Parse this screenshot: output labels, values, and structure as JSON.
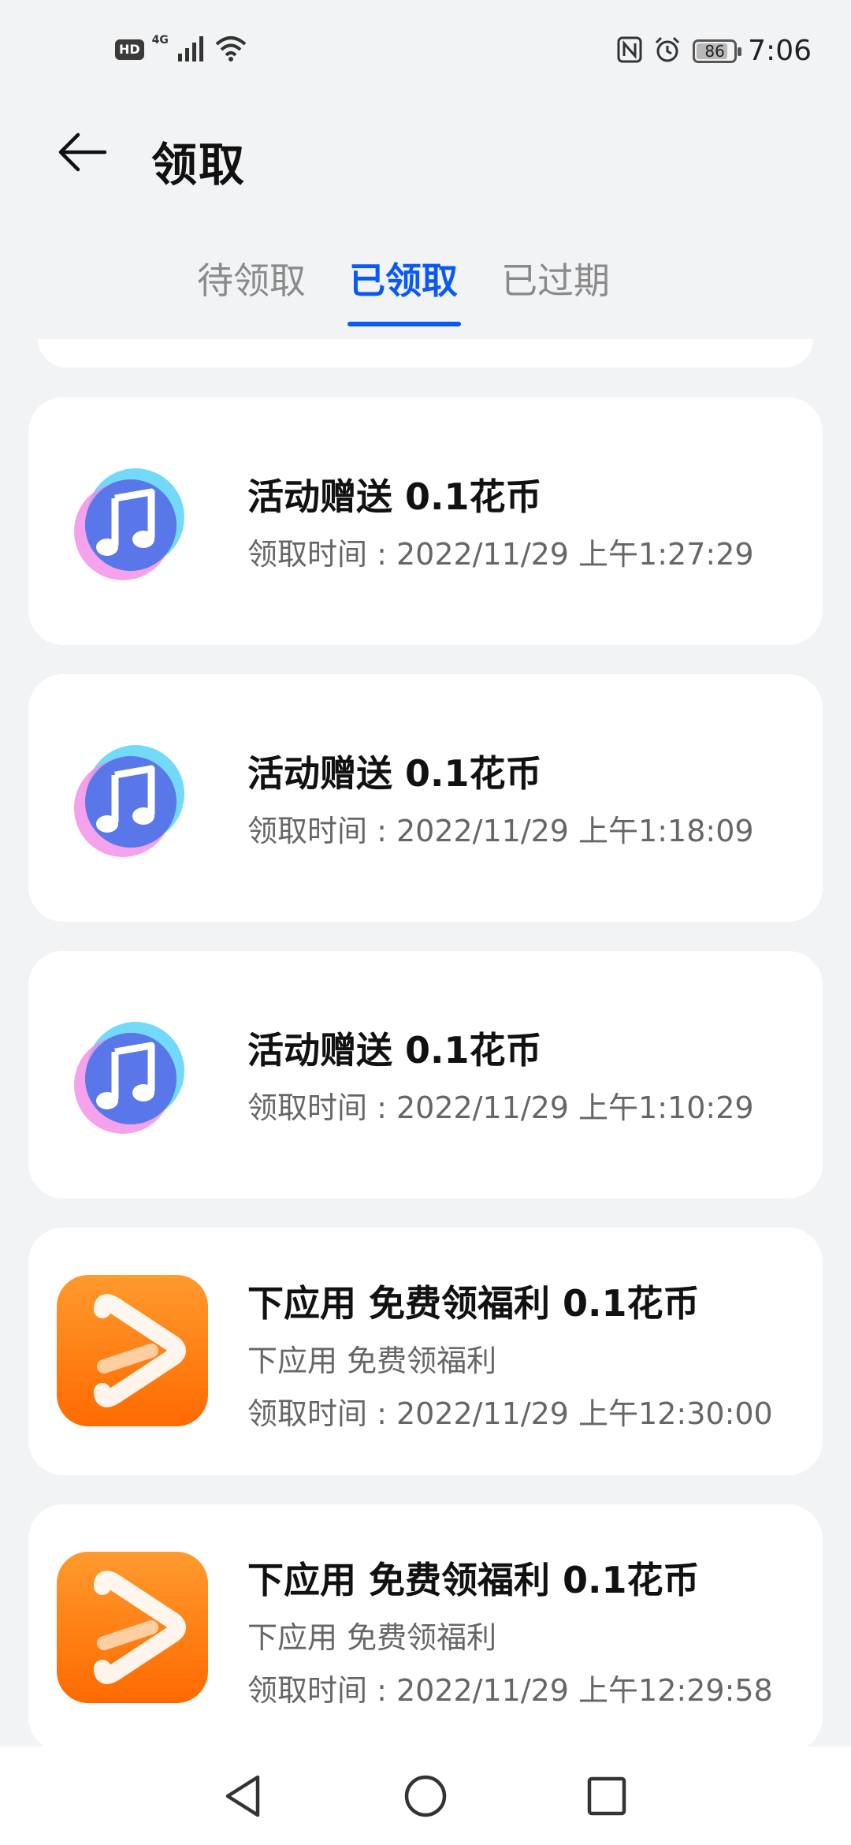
{
  "status_bar": {
    "left_badge": "HD",
    "network": "4G",
    "battery": "86",
    "battery_level_percent": 86,
    "time": "7:06",
    "icons": [
      "nfc-icon",
      "alarm-icon",
      "battery-icon",
      "wifi-icon",
      "signal-icon"
    ]
  },
  "header": {
    "title": "领取",
    "back_icon": "arrow-left-icon"
  },
  "tabs": [
    {
      "label": "待领取",
      "active": false
    },
    {
      "label": "已领取",
      "active": true
    },
    {
      "label": "已过期",
      "active": false
    }
  ],
  "colors": {
    "accent": "#0a59f7",
    "background": "#f1f3f5",
    "card": "#ffffff"
  },
  "items": [
    {
      "icon": "music-app-icon",
      "title": "活动赠送 0.1花币",
      "subtitle": "",
      "time_label": "领取时间 : 2022/11/29 上午1:27:29"
    },
    {
      "icon": "music-app-icon",
      "title": "活动赠送 0.1花币",
      "subtitle": "",
      "time_label": "领取时间 : 2022/11/29 上午1:18:09"
    },
    {
      "icon": "music-app-icon",
      "title": "活动赠送 0.1花币",
      "subtitle": "",
      "time_label": "领取时间 : 2022/11/29 上午1:10:29"
    },
    {
      "icon": "video-app-icon",
      "title": "下应用 免费领福利 0.1花币",
      "subtitle": "下应用 免费领福利",
      "time_label": "领取时间 : 2022/11/29 上午12:30:00"
    },
    {
      "icon": "video-app-icon",
      "title": "下应用 免费领福利 0.1花币",
      "subtitle": "下应用 免费领福利",
      "time_label": "领取时间 : 2022/11/29 上午12:29:58"
    }
  ],
  "nav_bar": {
    "back": "triangle-back-icon",
    "home": "circle-home-icon",
    "recents": "square-recents-icon"
  }
}
